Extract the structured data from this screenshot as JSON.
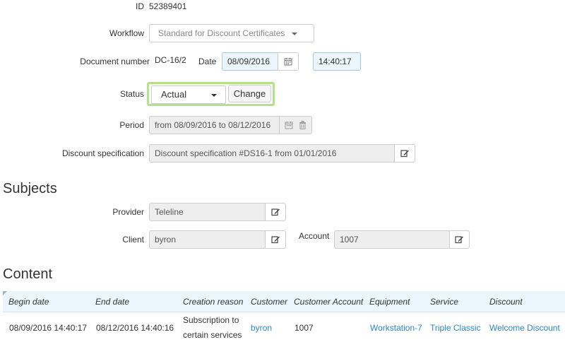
{
  "form": {
    "id_label": "ID",
    "id_value": "52389401",
    "workflow_label": "Workflow",
    "workflow_value": "Standard for Discount Certificates",
    "docnum_label": "Document number",
    "docnum_value": "DC-16/2",
    "date_label": "Date",
    "date_value": "08/09/2016",
    "time_value": "14:40:17",
    "status_label": "Status",
    "status_value": "Actual",
    "change_label": "Change",
    "period_label": "Period",
    "period_value": "from 08/09/2016 to 08/12/2016",
    "discount_spec_label": "Discount specification",
    "discount_spec_value": "Discount specification #DS16-1 from 01/01/2016"
  },
  "subjects": {
    "title": "Subjects",
    "provider_label": "Provider",
    "provider_value": "Teleline",
    "client_label": "Client",
    "client_value": "byron",
    "account_label": "Account",
    "account_value": "1007"
  },
  "content": {
    "title": "Content",
    "headers": [
      "Begin date",
      "End date",
      "Creation reason",
      "Customer",
      "Customer Account",
      "Equipment",
      "Service",
      "Discount"
    ],
    "rows": [
      {
        "begin": "08/09/2016 14:40:17",
        "end": "08/12/2016 14:40:16",
        "reason_line1": "Subscription to",
        "reason_line2": "certain services",
        "customer": "byron",
        "customer_account": "1007",
        "equipment": "Workstation-7",
        "service": "Triple Classic",
        "discount": "Welcome Discount"
      }
    ]
  },
  "icons": {
    "calendar": "calendar-icon",
    "trash": "trash-icon",
    "edit": "edit-icon",
    "caret": "caret-down-icon"
  },
  "colors": {
    "link": "#2a88c8",
    "status_highlight": "#b6e08c",
    "table_header_bg": "#eaf6fc"
  }
}
